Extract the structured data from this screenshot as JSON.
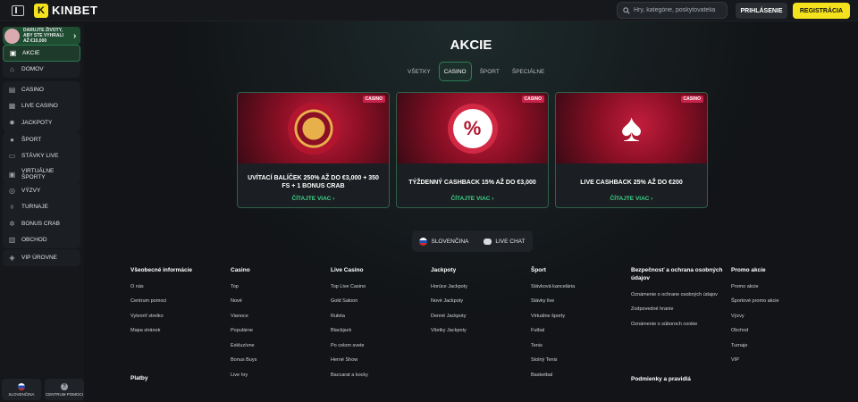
{
  "header": {
    "logo_text": "KINBET",
    "search_placeholder": "Hry, kategórie, poskytovatelia",
    "login_label": "PRIHLÁSENIE",
    "register_label": "REGISTRÁCIA"
  },
  "sidebar": {
    "promo_text": "Darujte životy, aby ste vyhrali až €10,000",
    "items": [
      {
        "label": "Akcie",
        "icon": "gift-icon"
      },
      {
        "label": "Domov",
        "icon": "home-icon"
      },
      {
        "label": "Casino",
        "icon": "slot-icon"
      },
      {
        "label": "Live Casino",
        "icon": "cards-icon"
      },
      {
        "label": "Jackpoty",
        "icon": "jackpot-icon"
      },
      {
        "label": "Šport",
        "icon": "ball-icon"
      },
      {
        "label": "Stávky live",
        "icon": "live-icon"
      },
      {
        "label": "Virtuálne športy",
        "icon": "virtual-icon"
      },
      {
        "label": "Výzvy",
        "icon": "challenge-icon"
      },
      {
        "label": "Turnaje",
        "icon": "trophy-icon"
      },
      {
        "label": "Bonus Crab",
        "icon": "crab-icon"
      },
      {
        "label": "Obchod",
        "icon": "shop-icon"
      },
      {
        "label": "VIP úrovne",
        "icon": "vip-icon"
      }
    ],
    "bottom": {
      "language": "Slovenčina",
      "help": "Centrum pomoci"
    }
  },
  "main": {
    "title": "AKCIE",
    "tabs": [
      "VŠETKY",
      "CASINO",
      "ŠPORT",
      "ŠPECIÁLNE"
    ],
    "cards": [
      {
        "badge": "CASINO",
        "title": "UVÍTACÍ BALÍČEK 250% AŽ DO €3,000 + 350 FS + 1 BONUS CRAB",
        "link": "ČÍTAJTE VIAC"
      },
      {
        "badge": "CASINO",
        "title": "TÝŽDENNÝ CASHBACK 15% AŽ DO €3,000",
        "link": "ČÍTAJTE VIAC"
      },
      {
        "badge": "CASINO",
        "title": "LIVE CASHBACK 25% AŽ DO €200",
        "link": "ČÍTAJTE VIAC"
      }
    ],
    "language_button": "SLOVENČINA",
    "chat_button": "LIVE CHAT"
  },
  "footer": {
    "columns": [
      {
        "heading": "Všeobecné informácie",
        "links": [
          "O nás",
          "Centrum pomoci",
          "Vytvoriť stretko",
          "Mapa stránok"
        ]
      },
      {
        "heading": "Casino",
        "links": [
          "Top",
          "Nové",
          "Vianoce",
          "Populárne",
          "Exkluzívne",
          "Bonus Buys",
          "Live hry"
        ]
      },
      {
        "heading": "Live Casino",
        "links": [
          "Top Live Casino",
          "Gold Saloon",
          "Ruleta",
          "Blackjack",
          "Po celom svete",
          "Herné Show",
          "Baccarat a kocky"
        ]
      },
      {
        "heading": "Jackpoty",
        "links": [
          "Horúce Jackpoty",
          "Nové Jackpoty",
          "Denné Jackpoty",
          "Všetky Jackpoty"
        ]
      },
      {
        "heading": "Šport",
        "links": [
          "Stávková kancelária",
          "Stávky live",
          "Virtuálne športy",
          "Futbal",
          "Tenis",
          "Stolný Tenis",
          "Basketbal"
        ]
      },
      {
        "heading": "Bezpečnosť a ochrana osobných údajov",
        "links": [
          "Oznámenie o ochrane osobných údajov",
          "Zodpovedné hranie",
          "Oznámenie o súboroch cookie"
        ]
      },
      {
        "heading": "Promo akcie",
        "links": [
          "Promo akcie",
          "Športové promo akcie",
          "Výzvy",
          "Obchod",
          "Turnaje",
          "VIP"
        ]
      }
    ],
    "payments_heading": "Platby",
    "terms_heading": "Podmienky a pravidlá"
  },
  "colors": {
    "accent_green": "#3fd38a",
    "brand_yellow": "#f4e21c",
    "badge_red": "#c8234a"
  }
}
